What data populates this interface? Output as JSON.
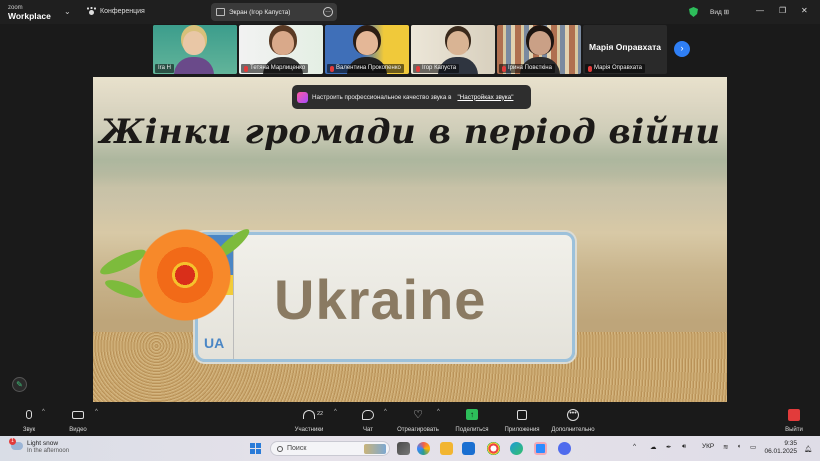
{
  "app": {
    "logo_line1": "zoom",
    "logo_line2": "Workplace",
    "meeting_name": "Конференция",
    "share_label": "Экран (Ігор Капуста)",
    "view_label": "Вид"
  },
  "participants": [
    {
      "name": "Ira H"
    },
    {
      "name": "Тетяна Марлиценко"
    },
    {
      "name": "Валентина Прокопенко"
    },
    {
      "name": "Ігор Капуста"
    },
    {
      "name": "Ірина Повєткіна"
    },
    {
      "name": "Марія Оправхата",
      "display": "Марія Оправхата"
    }
  ],
  "toast": {
    "text": "Настроить профессиональное качество звука в",
    "link": "\"Настройках звука\""
  },
  "slide": {
    "title": "Жінки громади в період війни",
    "plate_word": "Ukraine",
    "plate_code": "UA"
  },
  "controls": {
    "audio": "Звук",
    "video": "Видео",
    "participants": "Участники",
    "participants_count": "22",
    "chat": "Чат",
    "react": "Отреагировать",
    "share": "Поделиться",
    "apps": "Приложения",
    "more": "Дополнительно",
    "leave": "Выйти"
  },
  "taskbar": {
    "weather_title": "Light snow",
    "weather_sub": "In the afternoon",
    "weather_badge": "1",
    "search_placeholder": "Поиск",
    "lang": "УКР",
    "time": "9:35",
    "date": "06.01.2025"
  },
  "colors": {
    "accent_green": "#2dbd5a",
    "leave_red": "#e23b3b",
    "nav_blue": "#2f7ff5"
  }
}
